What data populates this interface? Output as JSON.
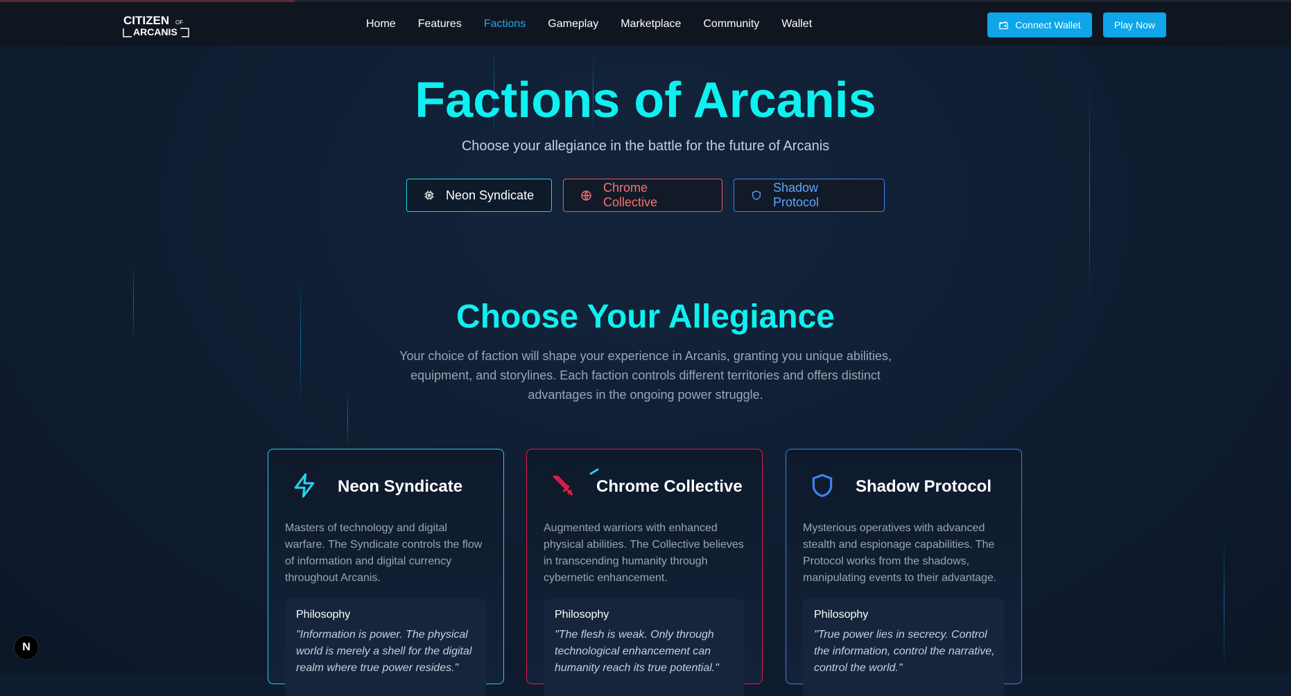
{
  "nav": {
    "logo_text": "CITIZEN OF ARCANIS",
    "links": [
      {
        "label": "Home"
      },
      {
        "label": "Features"
      },
      {
        "label": "Factions"
      },
      {
        "label": "Gameplay"
      },
      {
        "label": "Marketplace"
      },
      {
        "label": "Community"
      },
      {
        "label": "Wallet"
      }
    ],
    "active_link": "Factions",
    "connect_wallet_label": "Connect Wallet",
    "play_now_label": "Play Now"
  },
  "hero": {
    "title": "Factions of Arcanis",
    "subtitle": "Choose your allegiance in the battle for the future of Arcanis",
    "tabs": [
      {
        "label": "Neon Syndicate",
        "icon": "chip-icon",
        "color": "#22d3ee"
      },
      {
        "label": "Chrome Collective",
        "icon": "globe-icon",
        "color": "#f87171"
      },
      {
        "label": "Shadow Protocol",
        "icon": "shield-icon",
        "color": "#60a5fa"
      }
    ]
  },
  "section": {
    "title": "Choose Your Allegiance",
    "description": "Your choice of faction will shape your experience in Arcanis, granting you unique abilities, equipment, and storylines. Each faction controls different territories and offers distinct advantages in the ongoing power struggle."
  },
  "cards": [
    {
      "title": "Neon Syndicate",
      "icon": "lightning-icon",
      "color": "#22d3ee",
      "description": "Masters of technology and digital warfare. The Syndicate controls the flow of information and digital currency throughout Arcanis.",
      "philosophy_label": "Philosophy",
      "philosophy_quote": "\"Information is power. The physical world is merely a shell for the digital realm where true power resides.\""
    },
    {
      "title": "Chrome Collective",
      "icon": "sword-icon",
      "color": "#e11d48",
      "description": "Augmented warriors with enhanced physical abilities. The Collective believes in transcending humanity through cybernetic enhancement.",
      "philosophy_label": "Philosophy",
      "philosophy_quote": "\"The flesh is weak. Only through technological enhancement can humanity reach its true potential.\""
    },
    {
      "title": "Shadow Protocol",
      "icon": "shield-icon",
      "color": "#3b82f6",
      "description": "Mysterious operatives with advanced stealth and espionage capabilities. The Protocol works from the shadows, manipulating events to their advantage.",
      "philosophy_label": "Philosophy",
      "philosophy_quote": "\"True power lies in secrecy. Control the information, control the narrative, control the world.\""
    }
  ],
  "dev_badge": "N"
}
